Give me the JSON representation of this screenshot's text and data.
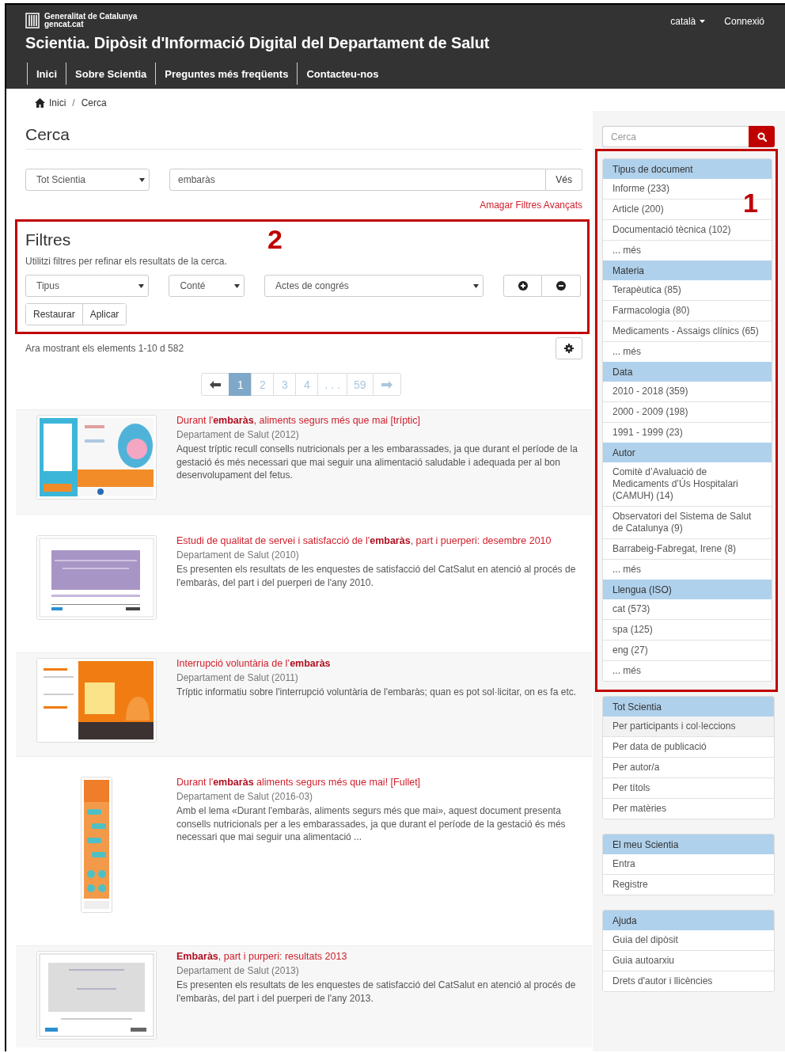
{
  "header": {
    "logo": {
      "line1": "Generalitat de Catalunya",
      "line2": "gencat.cat"
    },
    "language": "català",
    "login": "Connexió",
    "title": "Scientia. Dipòsit d'Informació Digital del Departament de Salut",
    "nav": [
      {
        "label": "Inici"
      },
      {
        "label": "Sobre Scientia"
      },
      {
        "label": "Preguntes més freqüents"
      },
      {
        "label": "Contacteu-nos"
      }
    ]
  },
  "breadcrumb": {
    "items": [
      "Inici",
      "Cerca"
    ],
    "separator": "/"
  },
  "search": {
    "heading": "Cerca",
    "scope": "Tot Scientia",
    "query": "embaràs",
    "go": "Vés",
    "toggle_link": "Amagar Filtres Avançats"
  },
  "filters": {
    "callout": "2",
    "heading": "Filtres",
    "hint": "Utilitzi filtres per refinar els resultats de la cerca.",
    "field": "Tipus",
    "operator": "Conté",
    "value": "Actes de congrés",
    "buttons": [
      "Restaurar",
      "Aplicar"
    ]
  },
  "results_summary": "Ara mostrant els elements 1-10 d 582",
  "pagination": [
    {
      "label": "1",
      "selected": true
    },
    {
      "label": "2",
      "selected": false
    },
    {
      "label": "3",
      "selected": false
    },
    {
      "label": "4",
      "selected": false
    },
    {
      "label": ". . .",
      "selected": false
    },
    {
      "label": "59",
      "selected": false
    }
  ],
  "results": [
    {
      "title": "Durant l'**embaràs**, aliments segurs més que mai [tríptic]",
      "meta": "Departament de Salut (2012)",
      "description": "Aquest tríptic recull consells nutricionals per a les embarassades, ja que durant el període de la gestació és més necessari que mai seguir una alimentació saludable i adequada per al bon desenvolupament del fetus."
    },
    {
      "title": "Estudi de qualitat de servei i satisfacció de l'**embaràs**, part i puerperi: desembre 2010",
      "meta": "Departament de Salut (2010)",
      "description": "Es presenten els resultats de les enquestes de satisfacció del CatSalut en atenció al procés de l'embaràs, del part i del puerperi de l'any 2010."
    },
    {
      "title": "Interrupció voluntària de l’**embaràs**",
      "meta": "Departament de Salut (2011)",
      "description": "Tríptic informatiu sobre l'interrupció voluntària de l'embaràs; quan es pot sol·licitar, on es fa etc."
    },
    {
      "title": "Durant l'**embaràs** aliments segurs més que mai! [Fullet]",
      "meta": "Departament de Salut (2016-03)",
      "description": "Amb el lema «Durant l'embaràs, aliments segurs més que mai», aquest document presenta consells nutricionals per a les embarassades, ja que durant el període de la gestació és més necessari que mai seguir una alimentació ..."
    },
    {
      "title": "**Embaràs**, part i purperi: resultats 2013",
      "meta": "Departament de Salut (2013)",
      "description": "Es presenten els resultats de les enquestes de satisfacció del CatSalut en atenció al procés de l'embaràs, del part i del puerperi de l'any 2013."
    }
  ],
  "sidebar": {
    "search_placeholder": "Cerca",
    "facets": {
      "callout": "1",
      "groups": [
        {
          "heading": "Tipus de document",
          "items": [
            "Informe (233)",
            "Article (200)",
            "Documentació tècnica (102)",
            "... més"
          ]
        },
        {
          "heading": "Materia",
          "items": [
            "Terapèutica (85)",
            "Farmacologia (80)",
            "Medicaments - Assaigs clínics (65)",
            "... més"
          ]
        },
        {
          "heading": "Data",
          "items": [
            "2010 - 2018 (359)",
            "2000 - 2009 (198)",
            "1991 - 1999 (23)"
          ]
        },
        {
          "heading": "Autor",
          "items": [
            "Comitè d’Avaluació de Medicaments d’Ús Hospitalari (CAMUH) (14)",
            "Observatori del Sistema de Salut de Catalunya (9)",
            "Barrabeig-Fabregat, Irene (8)",
            "... més"
          ]
        },
        {
          "heading": "Llengua (ISO)",
          "items": [
            "cat (573)",
            "spa (125)",
            "eng (27)",
            "... més"
          ]
        }
      ]
    },
    "panels": [
      {
        "heading": "Tot Scientia",
        "items": [
          {
            "label": "Per participants i col·leccions",
            "selected": true
          },
          {
            "label": "Per data de publicació",
            "selected": false
          },
          {
            "label": "Per autor/a",
            "selected": false
          },
          {
            "label": "Per títols",
            "selected": false
          },
          {
            "label": "Per matèries",
            "selected": false
          }
        ]
      },
      {
        "heading": "El meu Scientia",
        "items": [
          {
            "label": "Entra",
            "selected": false
          },
          {
            "label": "Registre",
            "selected": false
          }
        ]
      },
      {
        "heading": "Ajuda",
        "items": [
          {
            "label": "Guia del dipòsit",
            "selected": false
          },
          {
            "label": "Guia autoarxiu",
            "selected": false
          },
          {
            "label": "Drets d'autor i llicències",
            "selected": false
          }
        ]
      }
    ]
  }
}
